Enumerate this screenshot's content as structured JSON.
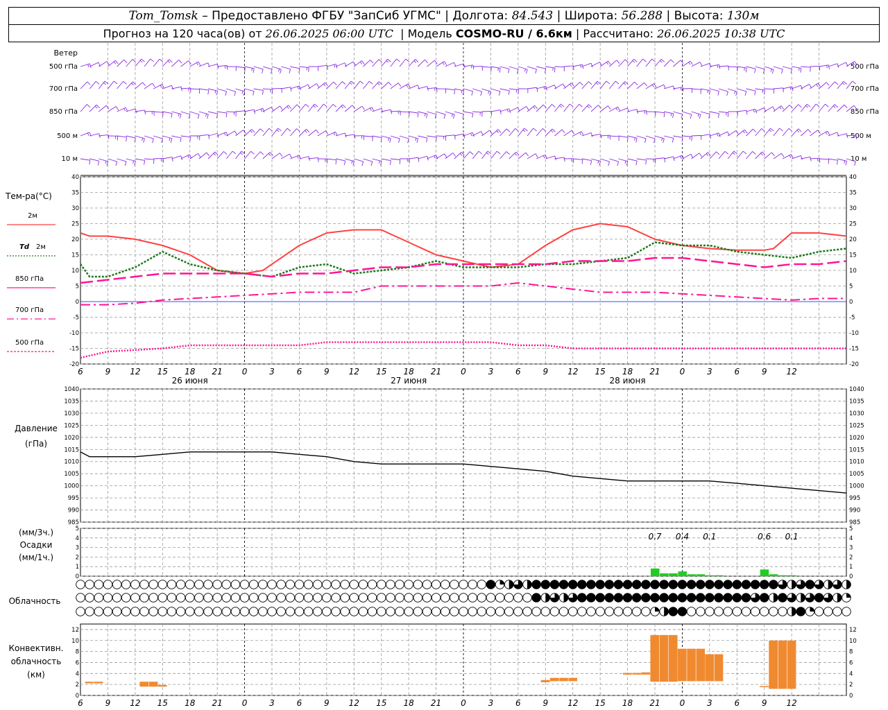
{
  "header": {
    "station": "Tom_Tomsk",
    "dash": " – ",
    "provider": "Предоставлено ФГБУ \"ЗапСиб УГМС\"",
    "lon_label": "Долгота:",
    "lon": "84.543",
    "lat_label": "Широта:",
    "lat": "56.288",
    "alt_label": "Высота:",
    "alt": "130м",
    "forecast_label": "Прогноз на 120 часа(ов) от",
    "forecast_from": "26.06.2025 06:00 UTC",
    "model_label": "Модель",
    "model": "COSMO-RU / 6.6км",
    "computed_label": "Рассчитано:",
    "computed": "26.06.2025 10:38 UTC"
  },
  "wind_panel": {
    "title": "Ветер",
    "levels": [
      "500 гПа",
      "700 гПа",
      "850 гПа",
      "500 м",
      "10  м"
    ],
    "color": "#8a2be2"
  },
  "temp_panel": {
    "ylabel": "Тем-ра(°C)",
    "ylim": [
      -20,
      40
    ],
    "yticks": [
      -20,
      -15,
      -10,
      -5,
      0,
      5,
      10,
      15,
      20,
      25,
      30,
      35,
      40
    ],
    "legend": [
      {
        "name": "2м",
        "color": "#ff4040",
        "dash": "solid"
      },
      {
        "name_prefix": "Td",
        "name": "2м",
        "color": "#1a7a1a",
        "dash": "dotted"
      },
      {
        "name": "850 гПа",
        "color": "#ff1493",
        "dash": "solid-line"
      },
      {
        "name": "700 гПа",
        "color": "#ff1493",
        "dash": "dashdot"
      },
      {
        "name": "500 гПа",
        "color": "#ff1493",
        "dash": "dotted"
      }
    ]
  },
  "time_axis": {
    "hour_labels": [
      "6",
      "9",
      "12",
      "15",
      "18",
      "21",
      "0",
      "3",
      "6",
      "9",
      "12",
      "15",
      "18",
      "21",
      "0",
      "3",
      "6",
      "9",
      "12",
      "15",
      "18",
      "21",
      "0",
      "3",
      "6",
      "9",
      "12"
    ],
    "day_labels": [
      {
        "text": "26 июня",
        "hour": 12
      },
      {
        "text": "27 июня",
        "hour": 36
      },
      {
        "text": "28 июня",
        "hour": 60
      }
    ]
  },
  "pressure_panel": {
    "ylabel1": "Давление",
    "ylabel2": "(гПа)",
    "ylim": [
      985,
      1040
    ],
    "yticks": [
      985,
      990,
      995,
      1000,
      1005,
      1010,
      1015,
      1020,
      1025,
      1030,
      1035,
      1040
    ]
  },
  "precip_panel": {
    "ylabel1": "(мм/3ч.)",
    "ylabel2": "Осадки",
    "ylabel3": "(мм/1ч.)",
    "ylim": [
      0,
      5
    ],
    "yticks": [
      0,
      1,
      2,
      3,
      4,
      5
    ],
    "amounts": [
      {
        "text": "0.7",
        "hour": 63
      },
      {
        "text": "0.4",
        "hour": 66
      },
      {
        "text": "0.1",
        "hour": 69
      },
      {
        "text": "0.6",
        "hour": 75
      },
      {
        "text": "0.1",
        "hour": 78
      }
    ],
    "color": "#22cc22"
  },
  "cloud_panel": {
    "label": "Облачность"
  },
  "conv_panel": {
    "ylabel1": "Конвективн.",
    "ylabel2": "облачность",
    "ylabel3": "(км)",
    "ylim": [
      0,
      13
    ],
    "yticks": [
      0,
      2,
      4,
      6,
      8,
      10,
      12
    ],
    "color": "#f08a30"
  },
  "chart_data": [
    {
      "type": "line",
      "title": "Тем-ра(°C)",
      "x_unit": "hours from 26.06.2025 06:00 UTC",
      "ylim": [
        -20,
        40
      ],
      "grid": true,
      "series": [
        {
          "name": "2м",
          "x": [
            0,
            1,
            3,
            6,
            9,
            12,
            15,
            18,
            20,
            24,
            27,
            30,
            33,
            36,
            39,
            42,
            45,
            48,
            51,
            54,
            57,
            60,
            63,
            66,
            69,
            72,
            75,
            76,
            78,
            81,
            84
          ],
          "values": [
            22,
            21,
            21,
            20,
            18,
            15,
            10,
            9,
            10,
            18,
            22,
            23,
            23,
            19,
            15,
            13,
            11,
            12,
            18,
            23,
            25,
            24,
            20,
            18,
            17,
            16.5,
            16.5,
            17,
            22,
            22,
            21
          ]
        },
        {
          "name": "Td 2м",
          "x": [
            0,
            1,
            3,
            6,
            9,
            12,
            15,
            18,
            21,
            24,
            27,
            30,
            33,
            36,
            39,
            42,
            45,
            48,
            51,
            54,
            57,
            60,
            63,
            66,
            69,
            72,
            75,
            78,
            81,
            84
          ],
          "values": [
            12,
            8,
            8,
            11,
            16,
            12,
            10,
            9,
            8,
            11,
            12,
            9,
            10,
            11,
            13,
            11,
            11,
            11,
            12,
            12,
            13,
            14,
            19,
            18,
            18,
            16,
            15,
            14,
            16,
            17
          ]
        },
        {
          "name": "850 гПа",
          "x": [
            0,
            3,
            6,
            9,
            12,
            15,
            18,
            21,
            24,
            27,
            30,
            33,
            36,
            39,
            42,
            45,
            48,
            51,
            54,
            57,
            60,
            63,
            66,
            69,
            72,
            75,
            78,
            81,
            84
          ],
          "values": [
            6,
            7,
            8,
            9,
            9,
            9,
            9,
            8,
            9,
            9,
            10,
            11,
            11,
            12,
            12,
            12,
            12,
            12,
            13,
            13,
            13,
            14,
            14,
            13,
            12,
            11,
            12,
            12,
            13
          ]
        },
        {
          "name": "700 гПа",
          "x": [
            0,
            3,
            6,
            9,
            12,
            15,
            18,
            21,
            24,
            27,
            30,
            33,
            36,
            39,
            42,
            45,
            48,
            51,
            54,
            57,
            60,
            63,
            66,
            69,
            72,
            75,
            78,
            81,
            84
          ],
          "values": [
            -1,
            -1,
            -0.5,
            0.5,
            1,
            1.5,
            2,
            2.5,
            3,
            3,
            3,
            5,
            5,
            5,
            5,
            5,
            6,
            5,
            4,
            3,
            3,
            3,
            2.5,
            2,
            1.5,
            1,
            0.5,
            1,
            1
          ]
        },
        {
          "name": "500 гПа",
          "x": [
            0,
            3,
            6,
            9,
            12,
            15,
            18,
            21,
            24,
            27,
            30,
            33,
            36,
            39,
            42,
            45,
            48,
            51,
            54,
            57,
            60,
            63,
            66,
            69,
            72,
            75,
            78,
            81,
            84
          ],
          "values": [
            -18,
            -16,
            -15.5,
            -15,
            -14,
            -14,
            -14,
            -14,
            -14,
            -13,
            -13,
            -13,
            -13,
            -13,
            -13,
            -13,
            -14,
            -14,
            -15,
            -15,
            -15,
            -15,
            -15,
            -15,
            -15,
            -15,
            -15,
            -15,
            -15
          ]
        }
      ]
    },
    {
      "type": "line",
      "title": "Давление (гПа)",
      "x_unit": "hours from 26.06.2025 06:00 UTC",
      "ylim": [
        985,
        1040
      ],
      "grid": true,
      "series": [
        {
          "name": "Давление",
          "x": [
            0,
            1,
            3,
            6,
            9,
            12,
            15,
            18,
            21,
            24,
            27,
            30,
            33,
            36,
            39,
            42,
            45,
            48,
            51,
            54,
            57,
            60,
            63,
            66,
            69,
            72,
            75,
            78,
            81,
            84
          ],
          "values": [
            1014,
            1012,
            1012,
            1012,
            1013,
            1014,
            1014,
            1014,
            1014,
            1013,
            1012,
            1010,
            1009,
            1009,
            1009,
            1009,
            1008,
            1007,
            1006,
            1004,
            1003,
            1002,
            1002,
            1002,
            1002,
            1001,
            1000,
            999,
            998,
            997
          ]
        }
      ]
    },
    {
      "type": "bar",
      "title": "Осадки",
      "x_unit": "hours from 26.06.2025 06:00 UTC",
      "ylim": [
        0,
        5
      ],
      "x": [
        63,
        64,
        65,
        66,
        67,
        68,
        69,
        70,
        75,
        76,
        77,
        78
      ],
      "values": [
        0.8,
        0.3,
        0.3,
        0.5,
        0.2,
        0.2,
        0.1,
        0.1,
        0.7,
        0.2,
        0.1,
        0.1
      ]
    },
    {
      "type": "bar",
      "title": "Конвективн. облачность (км)",
      "x_unit": "hours from 26.06.2025 06:00 UTC",
      "ylim": [
        0,
        13
      ],
      "bars": [
        {
          "x0": 0.5,
          "x1": 2.5,
          "bottom": 2.2,
          "top": 2.5
        },
        {
          "x0": 6.5,
          "x1": 8.5,
          "bottom": 1.6,
          "top": 2.5
        },
        {
          "x0": 8.5,
          "x1": 9.5,
          "bottom": 1.6,
          "top": 1.9
        },
        {
          "x0": 50.5,
          "x1": 51.5,
          "bottom": 2.4,
          "top": 2.8
        },
        {
          "x0": 51.5,
          "x1": 54.5,
          "bottom": 2.6,
          "top": 3.2
        },
        {
          "x0": 59.5,
          "x1": 61.5,
          "bottom": 3.8,
          "top": 4.1
        },
        {
          "x0": 61.5,
          "x1": 62.5,
          "bottom": 3.8,
          "top": 4.2
        },
        {
          "x0": 62.5,
          "x1": 65.5,
          "bottom": 2.5,
          "top": 11
        },
        {
          "x0": 65.5,
          "x1": 68.5,
          "bottom": 2.6,
          "top": 8.5
        },
        {
          "x0": 68.5,
          "x1": 70.5,
          "bottom": 2.6,
          "top": 7.5
        },
        {
          "x0": 74.5,
          "x1": 75.5,
          "bottom": 1.5,
          "top": 1.7
        },
        {
          "x0": 75.5,
          "x1": 78.5,
          "bottom": 1.2,
          "top": 10
        }
      ]
    },
    {
      "type": "table",
      "title": "Облачность",
      "x_unit": "hours from 26.06.2025 06:00 UTC",
      "rows": [
        {
          "name": "row1",
          "hours": [
            45,
            46,
            47,
            48,
            49,
            50,
            51,
            52,
            53,
            54,
            55,
            56,
            57,
            58,
            59,
            60,
            61,
            62,
            63,
            64,
            65,
            66,
            67,
            68,
            69,
            70,
            71,
            72,
            73,
            74,
            75,
            76,
            77,
            78,
            79,
            80,
            81,
            82,
            83,
            84
          ],
          "cover": [
            8,
            2,
            4,
            6,
            4,
            8,
            8,
            8,
            8,
            8,
            8,
            8,
            8,
            8,
            8,
            8,
            8,
            8,
            8,
            8,
            8,
            8,
            8,
            8,
            8,
            8,
            8,
            8,
            8,
            8,
            8,
            8,
            6,
            4,
            6,
            8,
            6,
            4,
            6,
            4
          ]
        },
        {
          "name": "row2",
          "hours": [
            50,
            51,
            52,
            53,
            54,
            55,
            56,
            57,
            58,
            59,
            60,
            61,
            62,
            63,
            64,
            65,
            66,
            67,
            68,
            69,
            70,
            71,
            72,
            73,
            74,
            75,
            76,
            77,
            78,
            79,
            80,
            81,
            82,
            83,
            84
          ],
          "cover": [
            8,
            4,
            6,
            4,
            6,
            8,
            8,
            8,
            8,
            8,
            8,
            8,
            8,
            8,
            8,
            8,
            8,
            8,
            8,
            8,
            8,
            8,
            8,
            8,
            6,
            8,
            4,
            8,
            6,
            4,
            6,
            8,
            6,
            4,
            2
          ]
        },
        {
          "name": "row3",
          "hours": [
            63,
            64,
            65,
            66,
            78,
            79,
            80,
            81
          ],
          "cover": [
            2,
            4,
            8,
            8,
            4,
            8,
            2,
            0
          ]
        }
      ]
    }
  ]
}
